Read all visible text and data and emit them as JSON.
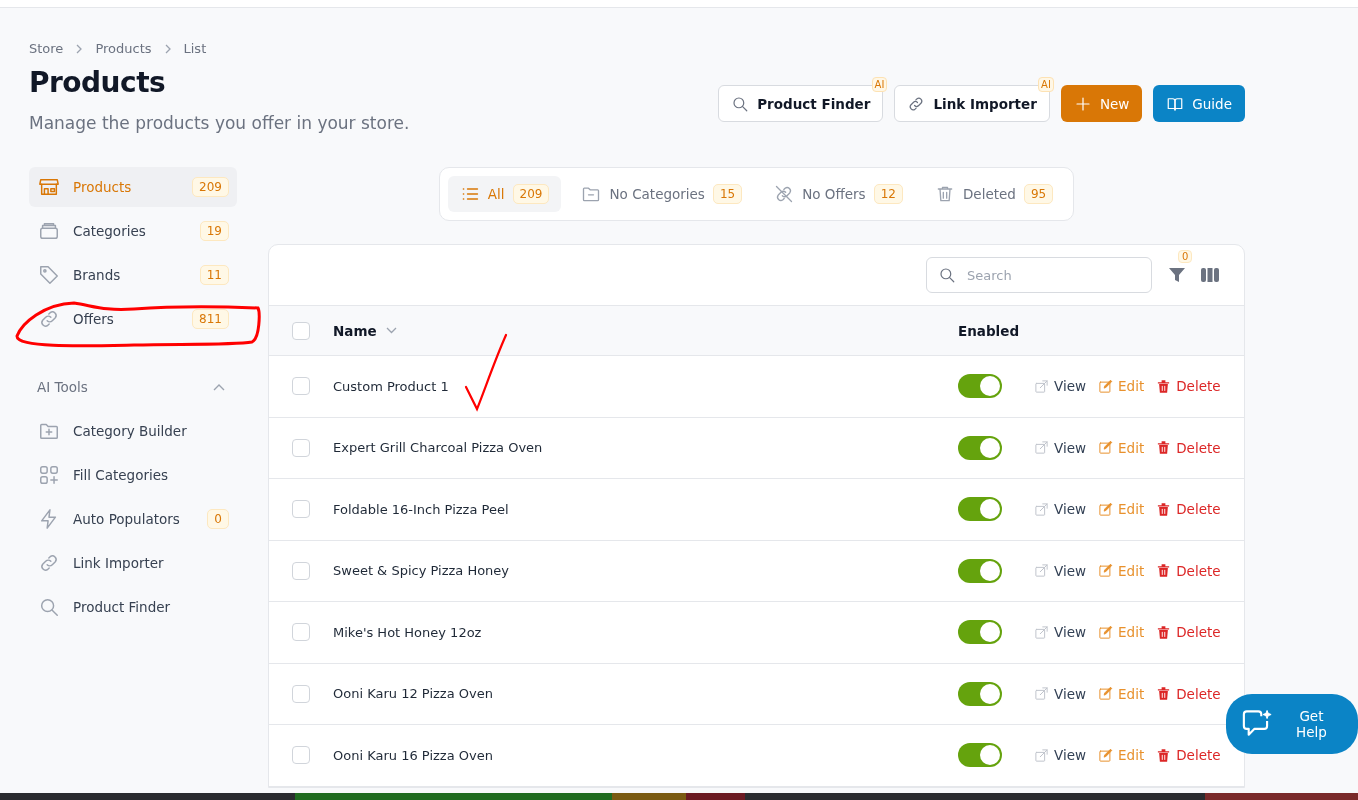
{
  "breadcrumb": [
    "Store",
    "Products",
    "List"
  ],
  "title": "Products",
  "subtitle": "Manage the products you offer in your store.",
  "header_actions": [
    {
      "label": "Product Finder",
      "kind": "outline",
      "badge": "AI"
    },
    {
      "label": "Link Importer",
      "kind": "outline",
      "badge": "AI"
    },
    {
      "label": "New",
      "kind": "primary"
    },
    {
      "label": "Guide",
      "kind": "info"
    }
  ],
  "sidebar": {
    "items": [
      {
        "label": "Products",
        "count": "209",
        "selected": true
      },
      {
        "label": "Categories",
        "count": "19",
        "selected": false
      },
      {
        "label": "Brands",
        "count": "11",
        "selected": false
      },
      {
        "label": "Offers",
        "count": "811",
        "selected": false
      }
    ],
    "section": {
      "title": "AI Tools",
      "expanded": true,
      "items": [
        {
          "label": "Category Builder"
        },
        {
          "label": "Fill Categories"
        },
        {
          "label": "Auto Populators",
          "count": "0"
        },
        {
          "label": "Link Importer"
        },
        {
          "label": "Product Finder"
        }
      ]
    }
  },
  "filter_tabs": [
    {
      "label": "All",
      "count": "209",
      "selected": true
    },
    {
      "label": "No Categories",
      "count": "15",
      "selected": false
    },
    {
      "label": "No Offers",
      "count": "12",
      "selected": false
    },
    {
      "label": "Deleted",
      "count": "95",
      "selected": false
    }
  ],
  "table": {
    "search": {
      "placeholder": "Search"
    },
    "filter_count": "0",
    "select_all_checked": false,
    "columns": [
      "Name",
      "Enabled"
    ],
    "rows": [
      {
        "name": "Custom Product 1",
        "checked": false,
        "enabled": true,
        "actions": [
          "View",
          "Edit",
          "Delete"
        ]
      },
      {
        "name": "Expert Grill Charcoal Pizza Oven",
        "checked": false,
        "enabled": true,
        "actions": [
          "View",
          "Edit",
          "Delete"
        ]
      },
      {
        "name": "Foldable 16-Inch Pizza Peel",
        "checked": false,
        "enabled": true,
        "actions": [
          "View",
          "Edit",
          "Delete"
        ]
      },
      {
        "name": "Sweet & Spicy Pizza Honey",
        "checked": false,
        "enabled": true,
        "actions": [
          "View",
          "Edit",
          "Delete"
        ]
      },
      {
        "name": "Mike's Hot Honey 12oz",
        "checked": false,
        "enabled": true,
        "actions": [
          "View",
          "Edit",
          "Delete"
        ]
      },
      {
        "name": "Ooni Karu 12 Pizza Oven",
        "checked": false,
        "enabled": true,
        "actions": [
          "View",
          "Edit",
          "Delete"
        ]
      },
      {
        "name": "Ooni Karu 16 Pizza Oven",
        "checked": false,
        "enabled": true,
        "actions": [
          "View",
          "Edit",
          "Delete"
        ]
      }
    ]
  },
  "help_button": {
    "label": "Get Help"
  }
}
